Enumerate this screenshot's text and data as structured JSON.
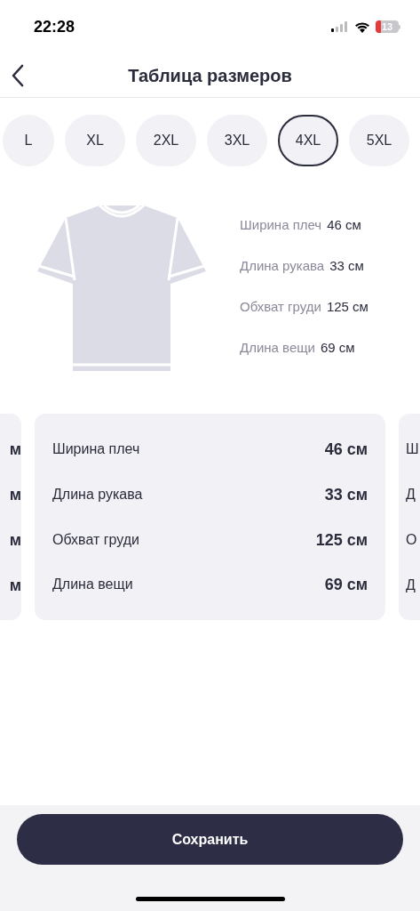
{
  "status_bar": {
    "time": "22:28",
    "battery": "13"
  },
  "header": {
    "title": "Таблица размеров"
  },
  "sizes": [
    {
      "label": "L",
      "selected": false
    },
    {
      "label": "XL",
      "selected": false
    },
    {
      "label": "2XL",
      "selected": false
    },
    {
      "label": "3XL",
      "selected": false
    },
    {
      "label": "4XL",
      "selected": true
    },
    {
      "label": "5XL",
      "selected": false
    }
  ],
  "measurements": [
    {
      "label": "Ширина плеч",
      "value": "46 см"
    },
    {
      "label": "Длина рукава",
      "value": "33 см"
    },
    {
      "label": "Обхват груди",
      "value": "125 см"
    },
    {
      "label": "Длина вещи",
      "value": "69 см"
    }
  ],
  "cards": [
    {
      "kind": "prev",
      "rows": [
        {
          "value": "м"
        },
        {
          "value": "м"
        },
        {
          "value": "м"
        },
        {
          "value": "м"
        }
      ]
    },
    {
      "kind": "current",
      "rows": [
        {
          "label": "Ширина плеч",
          "value": "46 см"
        },
        {
          "label": "Длина рукава",
          "value": "33 см"
        },
        {
          "label": "Обхват груди",
          "value": "125 см"
        },
        {
          "label": "Длина вещи",
          "value": "69 см"
        }
      ]
    },
    {
      "kind": "next",
      "rows": [
        {
          "label": "Ш"
        },
        {
          "label": "Д"
        },
        {
          "label": "О"
        },
        {
          "label": "Д"
        }
      ]
    }
  ],
  "save_button": "Сохранить"
}
